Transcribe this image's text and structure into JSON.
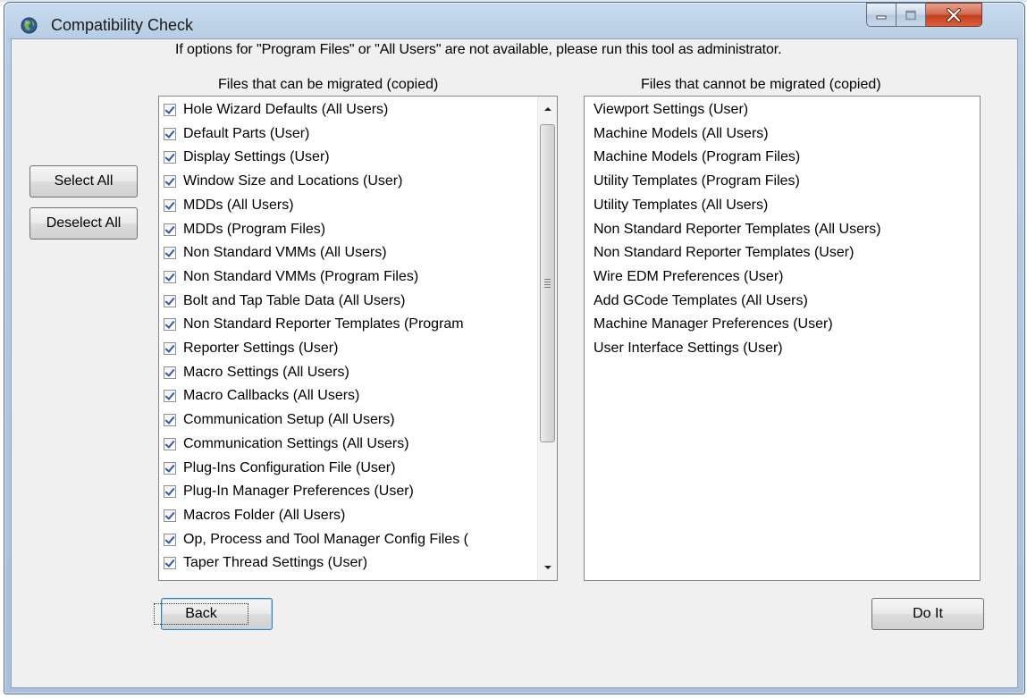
{
  "window": {
    "title": "Compatibility Check",
    "minimize_icon": "minimize-icon",
    "maximize_icon": "maximize-icon",
    "close_icon": "close-icon",
    "app_icon": "globe-icon"
  },
  "notice": "If options for \"Program Files\" or \"All Users\" are not available, please run this tool as administrator.",
  "left_list": {
    "header": "Files that can be migrated (copied)",
    "items": [
      {
        "label": "Hole Wizard Defaults (All Users)",
        "checked": true
      },
      {
        "label": "Default Parts (User)",
        "checked": true
      },
      {
        "label": "Display Settings (User)",
        "checked": true
      },
      {
        "label": "Window Size and Locations (User)",
        "checked": true
      },
      {
        "label": "MDDs (All Users)",
        "checked": true
      },
      {
        "label": "MDDs (Program Files)",
        "checked": true
      },
      {
        "label": "Non Standard VMMs (All Users)",
        "checked": true
      },
      {
        "label": "Non Standard VMMs (Program Files)",
        "checked": true
      },
      {
        "label": "Bolt and Tap Table Data (All Users)",
        "checked": true
      },
      {
        "label": "Non Standard Reporter Templates (Program",
        "checked": true
      },
      {
        "label": "Reporter Settings (User)",
        "checked": true
      },
      {
        "label": "Macro Settings (All Users)",
        "checked": true
      },
      {
        "label": "Macro Callbacks (All Users)",
        "checked": true
      },
      {
        "label": "Communication Setup (All Users)",
        "checked": true
      },
      {
        "label": "Communication Settings (All Users)",
        "checked": true
      },
      {
        "label": "Plug-Ins Configuration File (User)",
        "checked": true
      },
      {
        "label": "Plug-In Manager Preferences (User)",
        "checked": true
      },
      {
        "label": "Macros Folder (All Users)",
        "checked": true
      },
      {
        "label": "Op, Process and Tool Manager Config Files (",
        "checked": true
      },
      {
        "label": "Taper Thread Settings (User)",
        "checked": true
      }
    ]
  },
  "right_list": {
    "header": "Files that cannot be migrated (copied)",
    "items": [
      "Viewport Settings (User)",
      "Machine Models (All Users)",
      "Machine Models (Program Files)",
      "Utility Templates (Program Files)",
      "Utility Templates (All Users)",
      "Non Standard Reporter Templates (All Users)",
      "Non Standard Reporter Templates (User)",
      "Wire EDM Preferences (User)",
      "Add GCode Templates (All Users)",
      "Machine Manager Preferences (User)",
      "User Interface Settings (User)"
    ]
  },
  "buttons": {
    "select_all": "Select All",
    "deselect_all": "Deselect All",
    "back": "Back",
    "do_it": "Do It"
  },
  "colors": {
    "frame": "#b8cde4",
    "client": "#f0f0f0",
    "close_button": "#c2401f",
    "checkmark": "#2d58a8"
  }
}
